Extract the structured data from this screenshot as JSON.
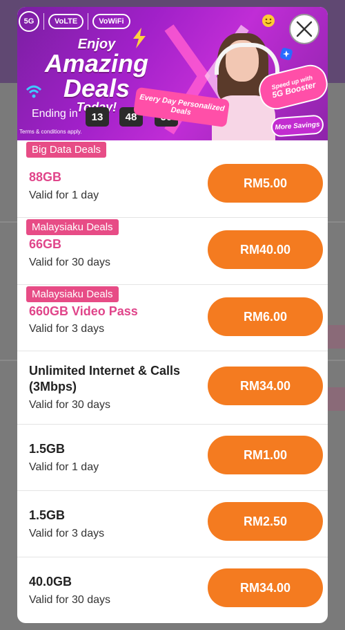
{
  "banner": {
    "badges": [
      "5G",
      "VoLTE",
      "VoWiFi"
    ],
    "headline": [
      "Enjoy",
      "Amazing",
      "Deals",
      "Today!"
    ],
    "ending_label": "Ending in",
    "countdown": [
      "13",
      "48",
      "50"
    ],
    "terms": "Terms & conditions apply.",
    "everyday_deals": "Every Day Personalized Deals",
    "booster_small": "Speed up with",
    "booster_big": "5G Booster",
    "more_savings": "More Savings"
  },
  "deals": [
    {
      "tag": "Big Data Deals",
      "title": "88GB",
      "validity": "Valid for 1 day",
      "price": "RM5.00",
      "highlight": true
    },
    {
      "tag": "Malaysiaku Deals",
      "title": "66GB",
      "validity": "Valid for 30 days",
      "price": "RM40.00",
      "highlight": true
    },
    {
      "tag": "Malaysiaku Deals",
      "title": "660GB Video Pass",
      "validity": "Valid for 3 days",
      "price": "RM6.00",
      "highlight": true
    },
    {
      "tag": "",
      "title": "Unlimited Internet & Calls (3Mbps)",
      "validity": "Valid for 30 days",
      "price": "RM34.00",
      "highlight": false
    },
    {
      "tag": "",
      "title": "1.5GB",
      "validity": "Valid for 1 day",
      "price": "RM1.00",
      "highlight": false
    },
    {
      "tag": "",
      "title": "1.5GB",
      "validity": "Valid for 3 days",
      "price": "RM2.50",
      "highlight": false
    },
    {
      "tag": "",
      "title": "40.0GB",
      "validity": "Valid for 30 days",
      "price": "RM34.00",
      "highlight": false
    }
  ],
  "colors": {
    "accent_orange": "#f47b20",
    "tag_pink": "#e74c86",
    "title_pink": "#e0458a",
    "banner_purple": "#a020c8"
  }
}
